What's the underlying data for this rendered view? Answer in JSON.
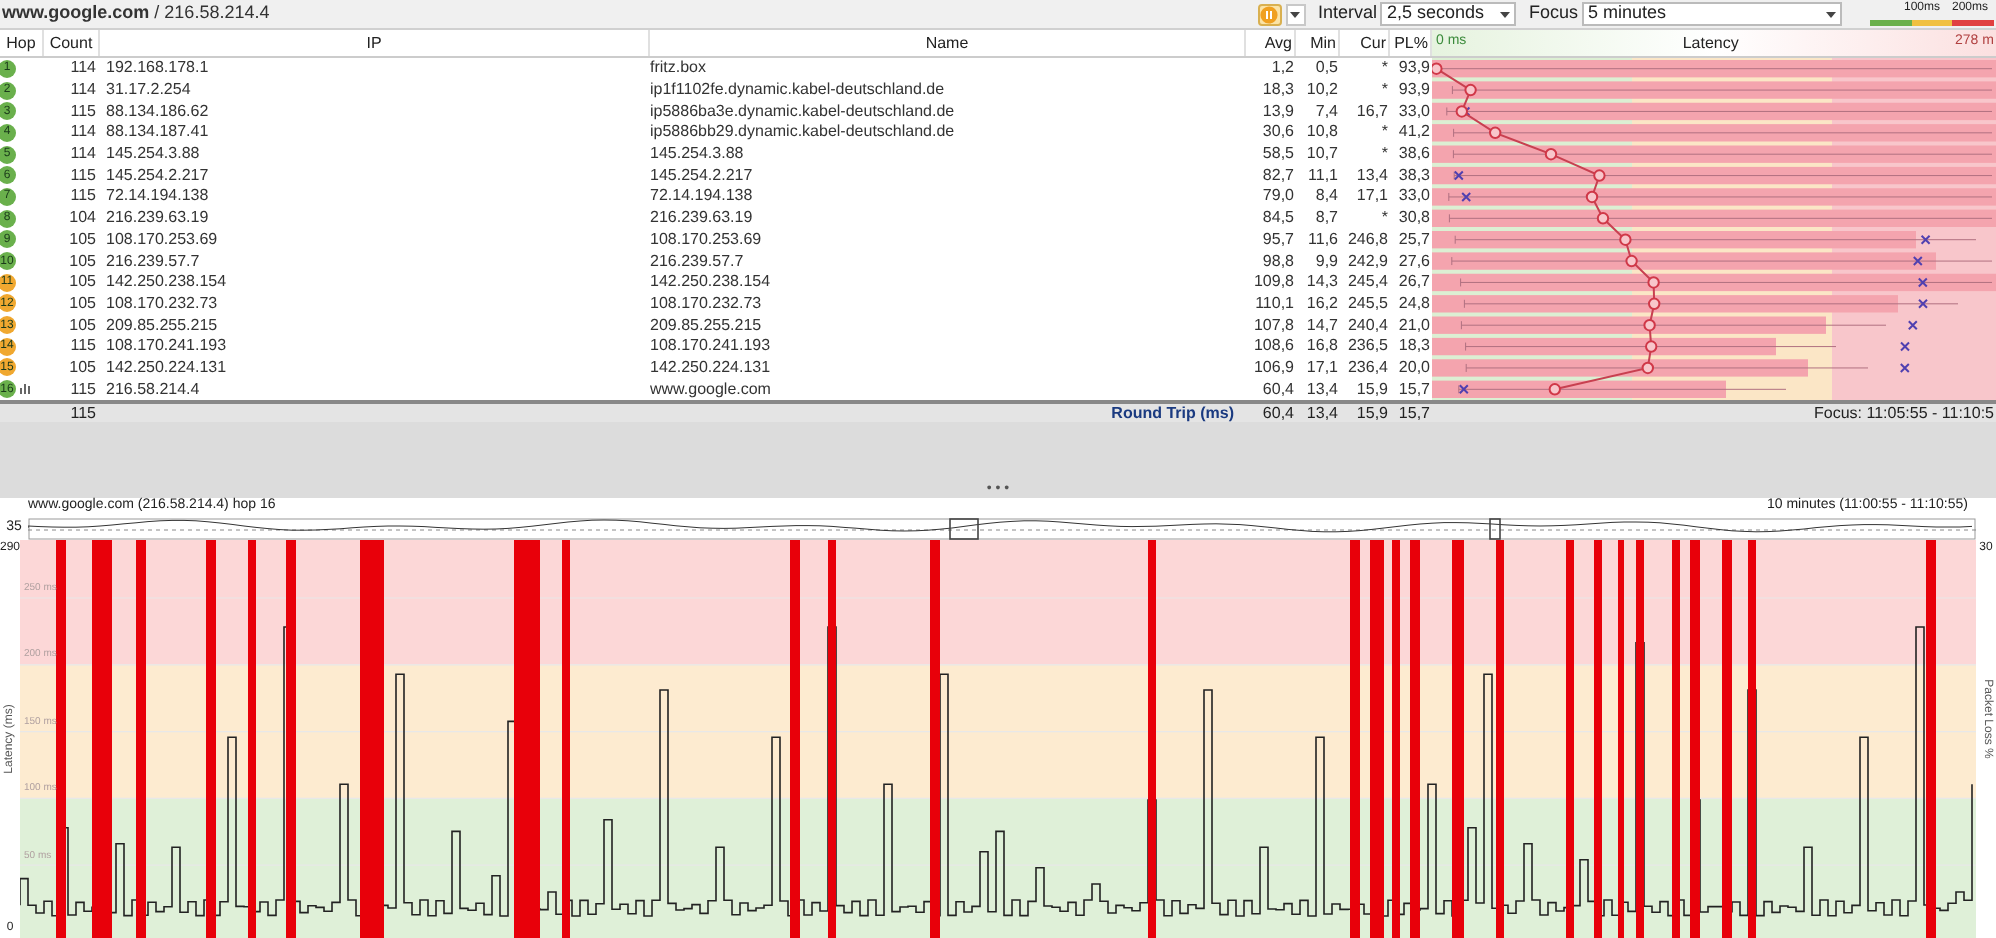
{
  "title": "**www.google.com** / 216.58.214.4",
  "toolbar": {
    "interval_label": "Interval",
    "interval": "2,5 seconds",
    "focus_label": "Focus",
    "focus": "5 minutes",
    "legend": [
      "100ms",
      "200ms"
    ]
  },
  "table": {
    "columns": [
      "Hop",
      "Count",
      "IP",
      "Name",
      "Avg",
      "Min",
      "Cur",
      "PL%"
    ],
    "latency_header": {
      "start": "0 ms",
      "title": "Latency",
      "end": "278 m"
    },
    "rows": [
      {
        "hop": "1",
        "color": "#6ab04c",
        "graphed": false,
        "count": "114",
        "ip": "192.168.178.1",
        "name": "fritz.box",
        "avg": "1,2",
        "min": "0,5",
        "cur": "*",
        "pl": "93,9"
      },
      {
        "hop": "2",
        "color": "#6ab04c",
        "graphed": false,
        "count": "114",
        "ip": "31.17.2.254",
        "name": "ip1f1102fe.dynamic.kabel-deutschland.de",
        "avg": "18,3",
        "min": "10,2",
        "cur": "*",
        "pl": "93,9"
      },
      {
        "hop": "3",
        "color": "#6ab04c",
        "graphed": false,
        "count": "115",
        "ip": "88.134.186.62",
        "name": "ip5886ba3e.dynamic.kabel-deutschland.de",
        "avg": "13,9",
        "min": "7,4",
        "cur": "16,7",
        "pl": "33,0"
      },
      {
        "hop": "4",
        "color": "#6ab04c",
        "graphed": false,
        "count": "114",
        "ip": "88.134.187.41",
        "name": "ip5886bb29.dynamic.kabel-deutschland.de",
        "avg": "30,6",
        "min": "10,8",
        "cur": "*",
        "pl": "41,2"
      },
      {
        "hop": "5",
        "color": "#6ab04c",
        "graphed": false,
        "count": "114",
        "ip": "145.254.3.88",
        "name": "145.254.3.88",
        "avg": "58,5",
        "min": "10,7",
        "cur": "*",
        "pl": "38,6"
      },
      {
        "hop": "6",
        "color": "#6ab04c",
        "graphed": false,
        "count": "115",
        "ip": "145.254.2.217",
        "name": "145.254.2.217",
        "avg": "82,7",
        "min": "11,1",
        "cur": "13,4",
        "pl": "38,3"
      },
      {
        "hop": "7",
        "color": "#6ab04c",
        "graphed": false,
        "count": "115",
        "ip": "72.14.194.138",
        "name": "72.14.194.138",
        "avg": "79,0",
        "min": "8,4",
        "cur": "17,1",
        "pl": "33,0"
      },
      {
        "hop": "8",
        "color": "#6ab04c",
        "graphed": false,
        "count": "104",
        "ip": "216.239.63.19",
        "name": "216.239.63.19",
        "avg": "84,5",
        "min": "8,7",
        "cur": "*",
        "pl": "30,8"
      },
      {
        "hop": "9",
        "color": "#6ab04c",
        "graphed": false,
        "count": "105",
        "ip": "108.170.253.69",
        "name": "108.170.253.69",
        "avg": "95,7",
        "min": "11,6",
        "cur": "246,8",
        "pl": "25,7"
      },
      {
        "hop": "10",
        "color": "#6ab04c",
        "graphed": false,
        "count": "105",
        "ip": "216.239.57.7",
        "name": "216.239.57.7",
        "avg": "98,8",
        "min": "9,9",
        "cur": "242,9",
        "pl": "27,6"
      },
      {
        "hop": "11",
        "color": "#f0a830",
        "graphed": false,
        "count": "105",
        "ip": "142.250.238.154",
        "name": "142.250.238.154",
        "avg": "109,8",
        "min": "14,3",
        "cur": "245,4",
        "pl": "26,7"
      },
      {
        "hop": "12",
        "color": "#f0a830",
        "graphed": false,
        "count": "105",
        "ip": "108.170.232.73",
        "name": "108.170.232.73",
        "avg": "110,1",
        "min": "16,2",
        "cur": "245,5",
        "pl": "24,8"
      },
      {
        "hop": "13",
        "color": "#f0a830",
        "graphed": false,
        "count": "105",
        "ip": "209.85.255.215",
        "name": "209.85.255.215",
        "avg": "107,8",
        "min": "14,7",
        "cur": "240,4",
        "pl": "21,0"
      },
      {
        "hop": "14",
        "color": "#f0a830",
        "graphed": false,
        "count": "115",
        "ip": "108.170.241.193",
        "name": "108.170.241.193",
        "avg": "108,6",
        "min": "16,8",
        "cur": "236,5",
        "pl": "18,3"
      },
      {
        "hop": "15",
        "color": "#f0a830",
        "graphed": false,
        "count": "105",
        "ip": "142.250.224.131",
        "name": "142.250.224.131",
        "avg": "106,9",
        "min": "17,1",
        "cur": "236,4",
        "pl": "20,0"
      },
      {
        "hop": "16",
        "color": "#6ab04c",
        "graphed": true,
        "count": "115",
        "ip": "216.58.214.4",
        "name": "www.google.com",
        "avg": "60,4",
        "min": "13,4",
        "cur": "15,9",
        "pl": "15,7"
      }
    ],
    "summary": {
      "count": "115",
      "label": "Round Trip (ms)",
      "avg": "60,4",
      "min": "13,4",
      "cur": "15,9",
      "pl": "15,7",
      "focus": "Focus: 11:05:55 - 11:10:5"
    }
  },
  "splitter": "• • •",
  "timeline": {
    "title": "www.google.com (216.58.214.4) hop 16",
    "range": "10 minutes (11:00:55 - 11:10:55)",
    "overview_label": "35",
    "y_max": "290",
    "y2_max": "30",
    "ylabel": "Latency (ms)",
    "y2label": "Packet Loss %",
    "yticks": [
      "250 ms",
      "200 ms",
      "150 ms",
      "100 ms",
      "50 ms",
      "0"
    ]
  }
}
